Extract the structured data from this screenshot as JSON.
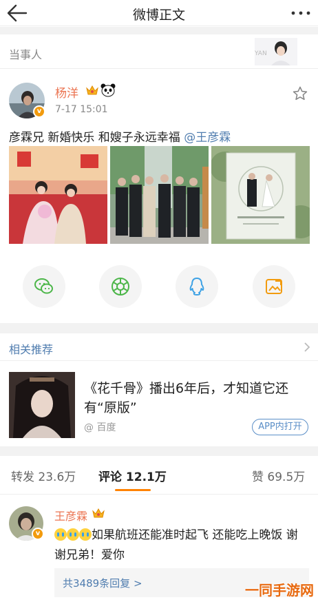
{
  "topbar": {
    "title": "微博正文"
  },
  "party": {
    "label": "当事人",
    "avatar_caption": "YAN"
  },
  "post": {
    "author": "杨洋",
    "time": "7-17 15:01",
    "text": "彦霖兄 新婚快乐 和嫂子永远幸福 ",
    "mention": "@王彦霖"
  },
  "share": [
    "wechat-icon",
    "moments-icon",
    "qq-icon",
    "weibo-share-icon"
  ],
  "related": {
    "label": "相关推荐",
    "title": "《花千骨》播出6年后，才知道它还有“原版”",
    "source": "@ 百度",
    "app_button": "APP内打开"
  },
  "tabs": {
    "repost_label": "转发",
    "repost_count": "23.6万",
    "comment_label": "评论",
    "comment_count": "12.1万",
    "like_label": "赞",
    "like_count": "69.5万"
  },
  "comment": {
    "author": "王彦霖",
    "text": "如果航班还能准时起飞 还能吃上晚饭 谢谢兄弟！爱你",
    "replies": "共3489条回复 >"
  },
  "watermark": "一同手游网",
  "colors": {
    "accent": "#ff8200",
    "name": "#eb7350",
    "link": "#507daf",
    "badge": "#f29b0e"
  }
}
